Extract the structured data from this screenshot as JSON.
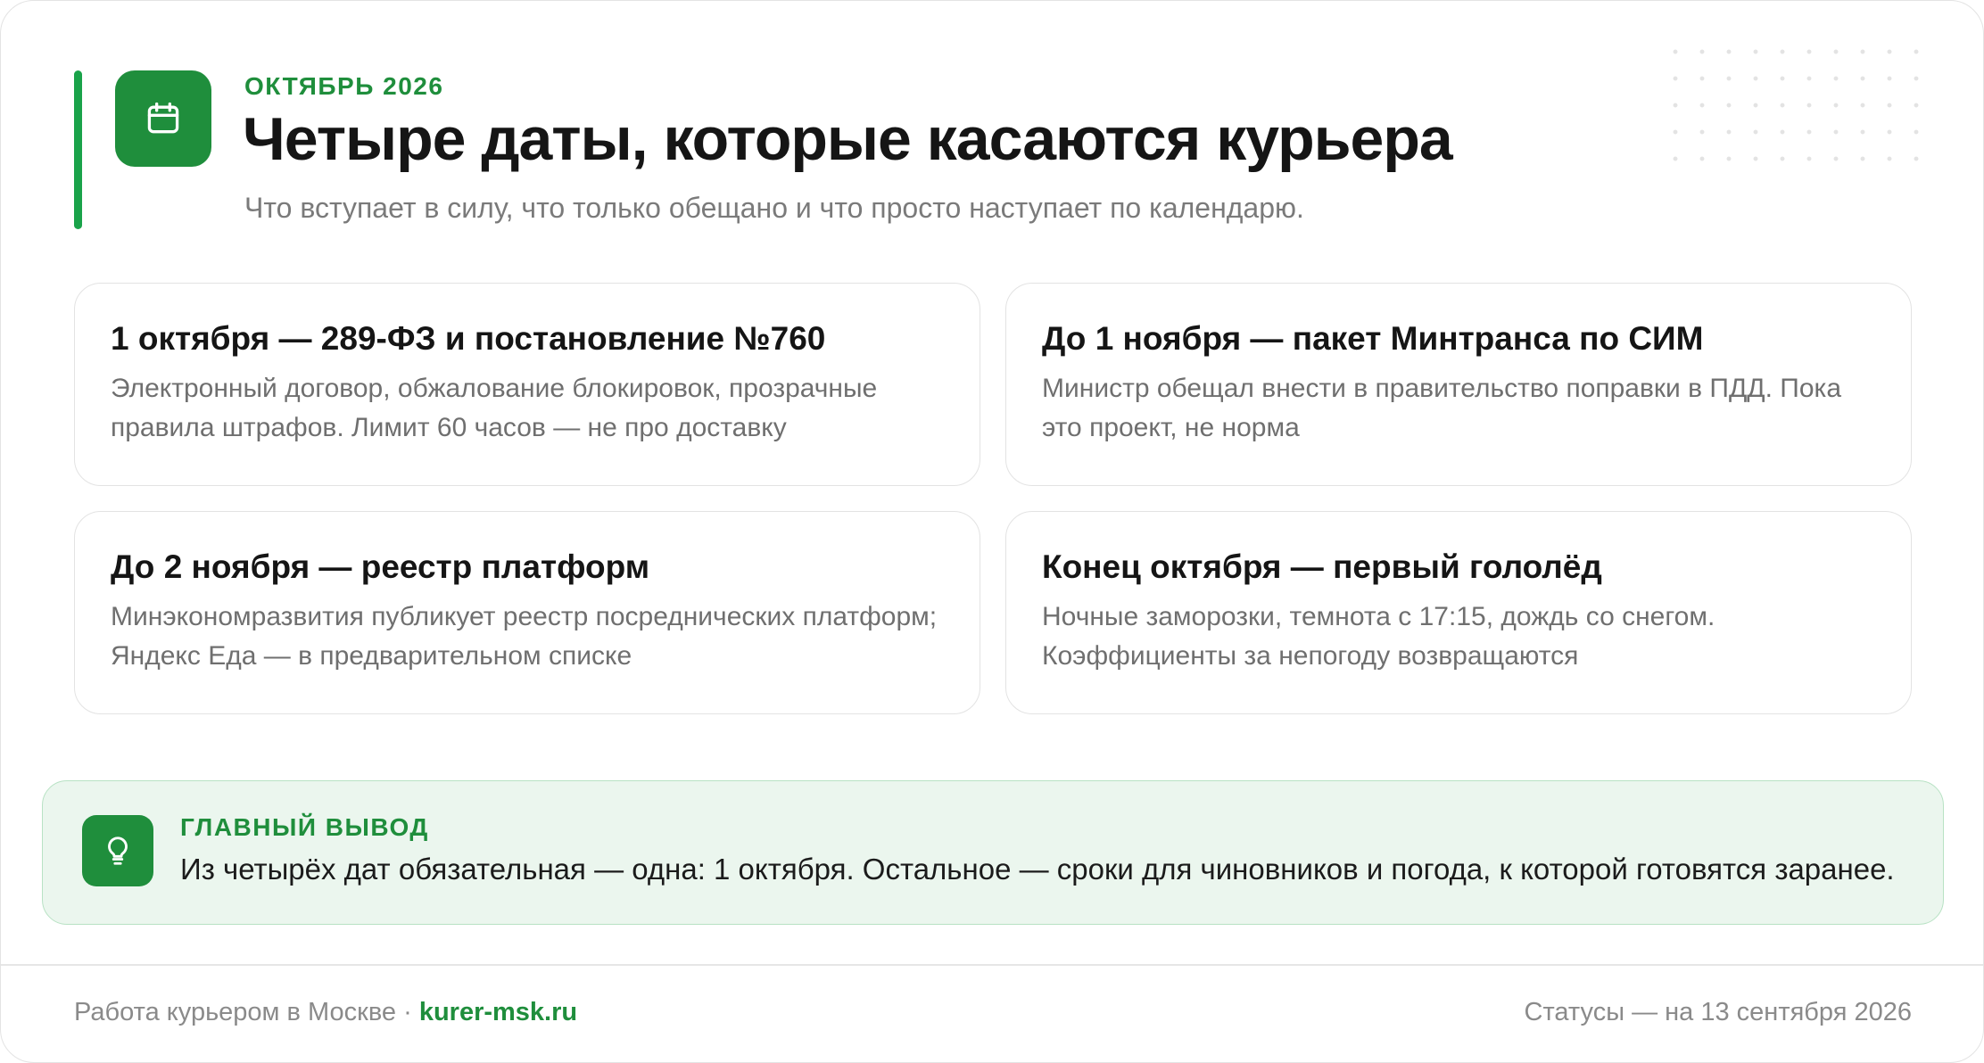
{
  "header": {
    "eyebrow": "ОКТЯБРЬ 2026",
    "title": "Четыре даты, которые касаются курьера",
    "subtitle": "Что вступает в силу, что только обещано и что просто наступает по календарю.",
    "icon": "calendar-icon"
  },
  "cards": [
    {
      "title": "1 октября — 289-ФЗ и постановление №760",
      "body": "Электронный договор, обжалование блокировок, прозрачные правила штрафов. Лимит 60 часов — не про доставку"
    },
    {
      "title": "До 1 ноября — пакет Минтранса по СИМ",
      "body": "Министр обещал внести в правительство поправки в ПДД. Пока это проект, не норма"
    },
    {
      "title": "До 2 ноября — реестр платформ",
      "body": "Минэкономразвития публикует реестр посреднических платформ; Яндекс Еда — в предварительном списке"
    },
    {
      "title": "Конец октября — первый гололёд",
      "body": "Ночные заморозки, темнота с 17:15, дождь со снегом. Коэффициенты за непогоду возвращаются"
    }
  ],
  "takeaway": {
    "label": "ГЛАВНЫЙ ВЫВОД",
    "text": "Из четырёх дат обязательная — одна: 1 октября. Остальное — сроки для чиновников и погода, к которой готовятся заранее.",
    "icon": "lightbulb-icon"
  },
  "footer": {
    "left_text": "Работа курьером в Москве · ",
    "site": "kurer-msk.ru",
    "right_text": "Статусы — на 13 сентября 2026"
  },
  "colors": {
    "accent": "#1f8e3c",
    "accent_bar": "#1aa34a",
    "takeaway_bg": "#ebf6ee",
    "takeaway_border": "#b8e2c4"
  }
}
